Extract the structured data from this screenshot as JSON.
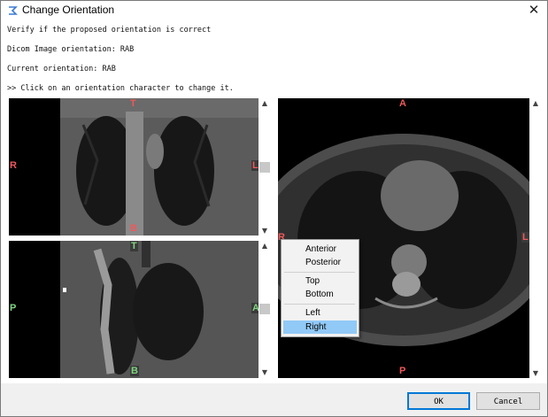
{
  "window": {
    "title": "Change Orientation",
    "close_glyph": "✕"
  },
  "messages": {
    "verify": "Verify if the proposed orientation is correct",
    "dicom": "Dicom Image orientation: RAB",
    "current": "Current orientation: RAB",
    "hint": ">> Click on an orientation character to change it."
  },
  "coronal": {
    "top": "T",
    "bottom": "B",
    "left": "R",
    "right": "L"
  },
  "sagittal": {
    "top": "T",
    "bottom": "B",
    "left": "P",
    "right": "A"
  },
  "axial": {
    "top": "A",
    "bottom": "P",
    "left": "R",
    "right": "L"
  },
  "scroll": {
    "up": "▲",
    "down": "▼"
  },
  "context_menu": {
    "items": [
      "Anterior",
      "Posterior",
      "Top",
      "Bottom",
      "Left",
      "Right"
    ],
    "selected": "Right"
  },
  "buttons": {
    "ok": "OK",
    "cancel": "Cancel"
  },
  "colors": {
    "label_red": "#f0585a",
    "label_green": "#7fd47f",
    "menu_highlight": "#91c9f7",
    "default_button_border": "#0078d7"
  }
}
